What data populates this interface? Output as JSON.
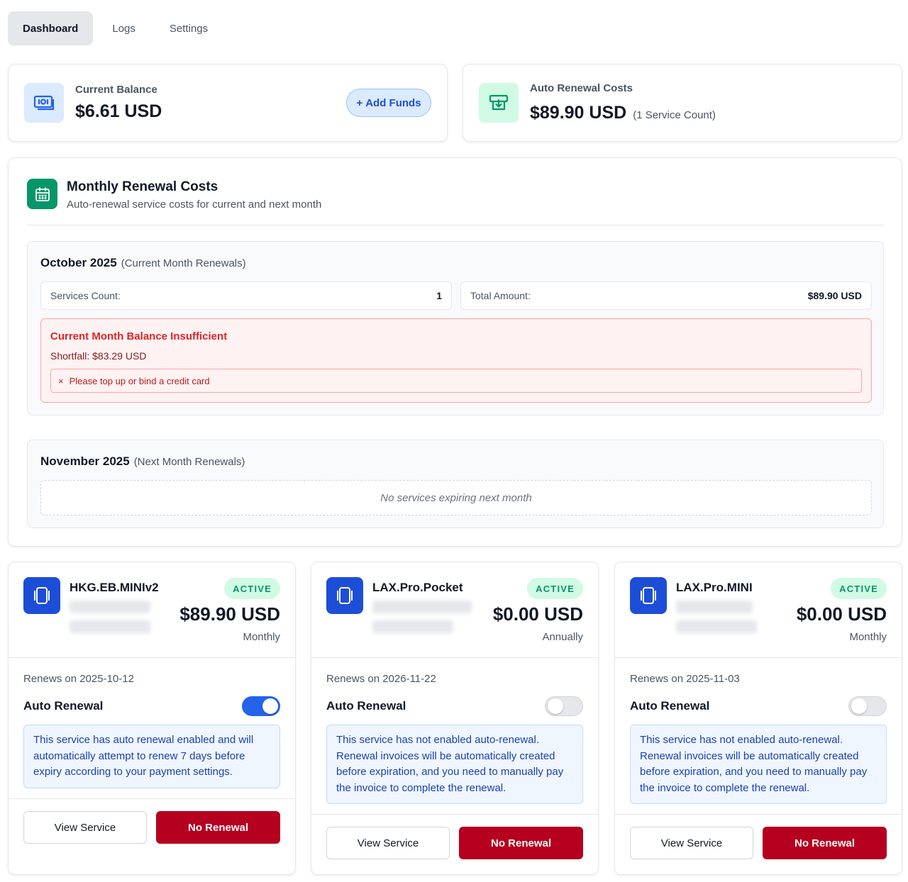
{
  "tabs": [
    {
      "label": "Dashboard",
      "active": true
    },
    {
      "label": "Logs",
      "active": false
    },
    {
      "label": "Settings",
      "active": false
    }
  ],
  "balance": {
    "label": "Current Balance",
    "value": "$6.61 USD",
    "add_funds_icon": "+",
    "add_funds_label": "Add Funds",
    "icon": "money-icon"
  },
  "auto_costs": {
    "label": "Auto Renewal Costs",
    "value": "$89.90 USD",
    "count": "(1 Service Count)",
    "icon": "download-box-icon"
  },
  "monthly": {
    "title": "Monthly Renewal Costs",
    "subtitle": "Auto-renewal service costs for current and next month",
    "icon": "calendar-icon",
    "current": {
      "month": "October 2025",
      "tag": "(Current Month Renewals)",
      "services_label": "Services Count:",
      "services_value": "1",
      "total_label": "Total Amount:",
      "total_value": "$89.90 USD",
      "alert_title": "Current Month Balance Insufficient",
      "alert_shortfall": "Shortfall: $83.29 USD",
      "alert_icon": "×",
      "alert_action": "Please top up or bind a credit card"
    },
    "next": {
      "month": "November 2025",
      "tag": "(Next Month Renewals)",
      "empty": "No services expiring next month"
    }
  },
  "services": [
    {
      "name": "HKG.EB.MINIv2",
      "status": "ACTIVE",
      "price": "$89.90 USD",
      "cycle": "Monthly",
      "renews": "Renews on 2025-10-12",
      "auto_label": "Auto Renewal",
      "auto_on": true,
      "info": "This service has auto renewal enabled and will automatically attempt to renew 7 days before expiry according to your payment settings.",
      "view_label": "View Service",
      "no_renew_label": "No Renewal"
    },
    {
      "name": "LAX.Pro.Pocket",
      "status": "ACTIVE",
      "price": "$0.00 USD",
      "cycle": "Annually",
      "renews": "Renews on 2026-11-22",
      "auto_label": "Auto Renewal",
      "auto_on": false,
      "info": "This service has not enabled auto-renewal. Renewal invoices will be automatically created before expiration, and you need to manually pay the invoice to complete the renewal.",
      "view_label": "View Service",
      "no_renew_label": "No Renewal"
    },
    {
      "name": "LAX.Pro.MINI",
      "status": "ACTIVE",
      "price": "$0.00 USD",
      "cycle": "Monthly",
      "renews": "Renews on 2025-11-03",
      "auto_label": "Auto Renewal",
      "auto_on": false,
      "info": "This service has not enabled auto-renewal. Renewal invoices will be automatically created before expiration, and you need to manually pay the invoice to complete the renewal.",
      "view_label": "View Service",
      "no_renew_label": "No Renewal"
    }
  ],
  "colors": {
    "brand_blue": "#1d4ed8",
    "danger": "#b5001f",
    "success": "#059669"
  }
}
